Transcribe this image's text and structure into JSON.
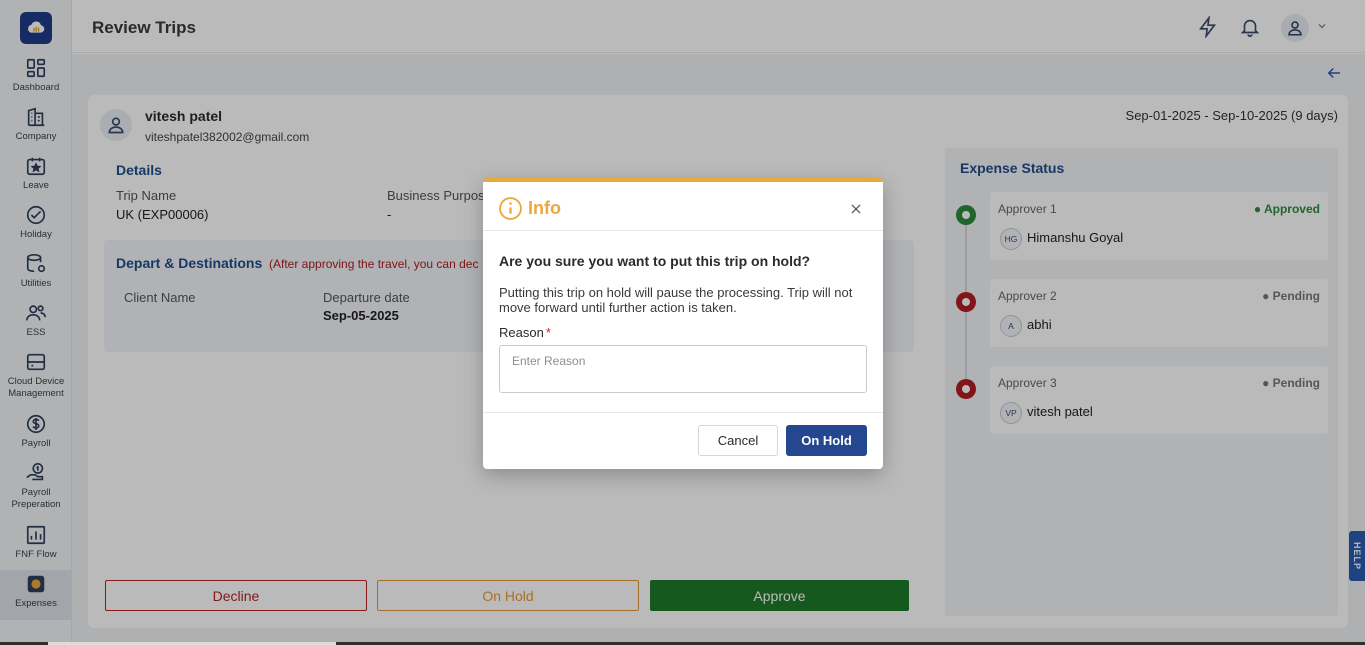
{
  "header": {
    "title": "Review Trips"
  },
  "sidebar": {
    "items": [
      {
        "label": "Dashboard",
        "icon": "dashboard-icon"
      },
      {
        "label": "Company",
        "icon": "building-icon"
      },
      {
        "label": "Leave",
        "icon": "calendar-star-icon"
      },
      {
        "label": "Holiday",
        "icon": "holiday-icon"
      },
      {
        "label": "Utilities",
        "icon": "database-gear-icon"
      },
      {
        "label": "ESS",
        "icon": "users-icon"
      },
      {
        "label": "Cloud Device Management",
        "icon": "device-icon"
      },
      {
        "label": "Payroll",
        "icon": "dollar-icon"
      },
      {
        "label": "Payroll Preperation",
        "icon": "hand-dollar-icon"
      },
      {
        "label": "FNF Flow",
        "icon": "chart-icon"
      },
      {
        "label": "Expenses",
        "icon": "expenses-icon"
      }
    ]
  },
  "trip": {
    "user_name": "vitesh patel",
    "user_email": "viteshpatel382002@gmail.com",
    "date_range": "Sep-01-2025 - Sep-10-2025 (9 days)",
    "details_title": "Details",
    "trip_name_label": "Trip Name",
    "trip_name_value": "UK (EXP00006)",
    "business_purpose_label": "Business Purpos",
    "business_purpose_value": "-",
    "destinations_title": "Depart & Destinations",
    "destinations_note": "(After approving the travel, you can dec",
    "client_name_label": "Client Name",
    "departure_date_label": "Departure date",
    "departure_date_value": "Sep-05-2025"
  },
  "actions": {
    "decline": "Decline",
    "on_hold": "On Hold",
    "approve": "Approve"
  },
  "expense_status": {
    "title": "Expense Status",
    "approvers": [
      {
        "label": "Approver 1",
        "status": "Approved",
        "initials": "HG",
        "name": "Himanshu Goyal"
      },
      {
        "label": "Approver 2",
        "status": "Pending",
        "initials": "A",
        "name": "abhi"
      },
      {
        "label": "Approver 3",
        "status": "Pending",
        "initials": "VP",
        "name": "vitesh patel"
      }
    ]
  },
  "help": {
    "label": "HELP"
  },
  "modal": {
    "title": "Info",
    "question": "Are you sure you want to put this trip on hold?",
    "description": "Putting this trip on hold will pause the processing. Trip will not move forward until further action is taken.",
    "reason_label": "Reason",
    "reason_required": "*",
    "reason_placeholder": "Enter Reason",
    "reason_value": "",
    "cancel": "Cancel",
    "confirm": "On Hold"
  },
  "colors": {
    "accent": "#e9a93b",
    "primary": "#24478f",
    "approve": "#1e7a2a",
    "decline": "#b82222"
  }
}
